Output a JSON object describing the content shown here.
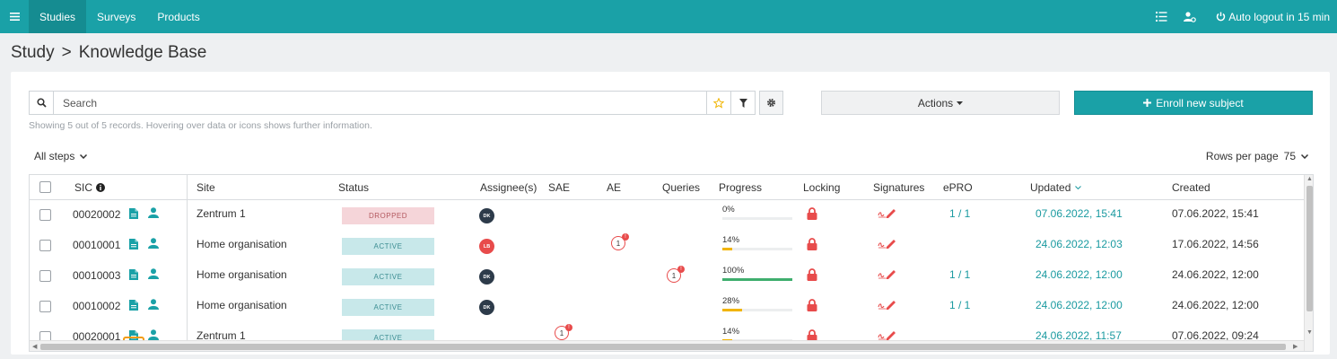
{
  "nav": {
    "tabs": [
      {
        "label": "Studies"
      },
      {
        "label": "Surveys"
      },
      {
        "label": "Products"
      }
    ],
    "logout_label": "Auto logout in 15 min"
  },
  "breadcrumb": {
    "parent": "Study",
    "separator": ">",
    "current": "Knowledge Base"
  },
  "toolbar": {
    "search_placeholder": "Search",
    "actions_label": "Actions",
    "enroll_label": "Enroll new subject"
  },
  "info_text": "Showing 5 out of 5 records. Hovering over data or icons shows further information.",
  "steps_label": "All steps",
  "rows_per_page": {
    "label": "Rows per page",
    "value": "75"
  },
  "table": {
    "columns": [
      "SIC",
      "Site",
      "Status",
      "Assignee(s)",
      "SAE",
      "AE",
      "Queries",
      "Progress",
      "Locking",
      "Signatures",
      "ePRO",
      "Updated",
      "Created"
    ],
    "rows": [
      {
        "sic": "00020002",
        "site": "Zentrum 1",
        "status": "DROPPED",
        "assignee": "DK",
        "sae": "",
        "ae": "",
        "queries": "",
        "progress": "0%",
        "progress_value": 0,
        "epro": "1 / 1",
        "updated": "07.06.2022, 15:41",
        "created": "07.06.2022, 15:41"
      },
      {
        "sic": "00010001",
        "site": "Home organisation",
        "status": "ACTIVE",
        "assignee": "LB",
        "sae": "",
        "ae": "1",
        "queries": "",
        "progress": "14%",
        "progress_value": 14,
        "epro": "",
        "updated": "24.06.2022, 12:03",
        "created": "17.06.2022, 14:56"
      },
      {
        "sic": "00010003",
        "site": "Home organisation",
        "status": "ACTIVE",
        "assignee": "DK",
        "sae": "",
        "ae": "",
        "queries": "1",
        "progress": "100%",
        "progress_value": 100,
        "epro": "1 / 1",
        "updated": "24.06.2022, 12:00",
        "created": "24.06.2022, 12:00"
      },
      {
        "sic": "00010002",
        "site": "Home organisation",
        "status": "ACTIVE",
        "assignee": "DK",
        "sae": "",
        "ae": "",
        "queries": "",
        "progress": "28%",
        "progress_value": 28,
        "epro": "1 / 1",
        "updated": "24.06.2022, 12:00",
        "created": "24.06.2022, 12:00"
      },
      {
        "sic": "00020001",
        "site": "Zentrum 1",
        "status": "ACTIVE",
        "assignee": "",
        "sae": "1",
        "ae": "",
        "queries": "",
        "progress": "14%",
        "progress_value": 14,
        "epro": "",
        "updated": "24.06.2022, 11:57",
        "created": "07.06.2022, 09:24"
      }
    ]
  },
  "colors": {
    "brand": "#1aa1a7",
    "danger": "#e84b4b",
    "progress_low": "#f1b400",
    "progress_full": "#3fae6e",
    "highlight": "#f39c12"
  }
}
